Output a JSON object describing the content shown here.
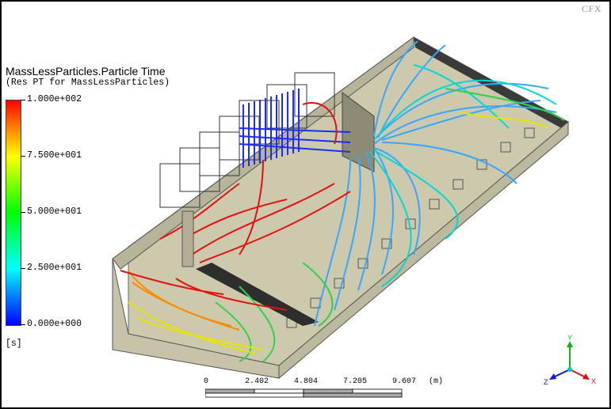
{
  "app": {
    "logo_text": "CFX"
  },
  "legend": {
    "title": "MassLessParticles.Particle Time",
    "subtitle": "(Res PT for MassLessParticles)",
    "ticks": [
      "1.000e+002",
      "7.500e+001",
      "5.000e+001",
      "2.500e+001",
      "0.000e+000"
    ],
    "unit": "[s]",
    "colors": [
      "#ff0000",
      "#ffff00",
      "#00ff00",
      "#00ffff",
      "#0000ff"
    ]
  },
  "scale_bar": {
    "labels": [
      "0",
      "2.402",
      "4.804",
      "7.205",
      "9.607"
    ],
    "unit": "(m)"
  },
  "axes": {
    "y": "Y",
    "x": "X",
    "z": "Z"
  }
}
